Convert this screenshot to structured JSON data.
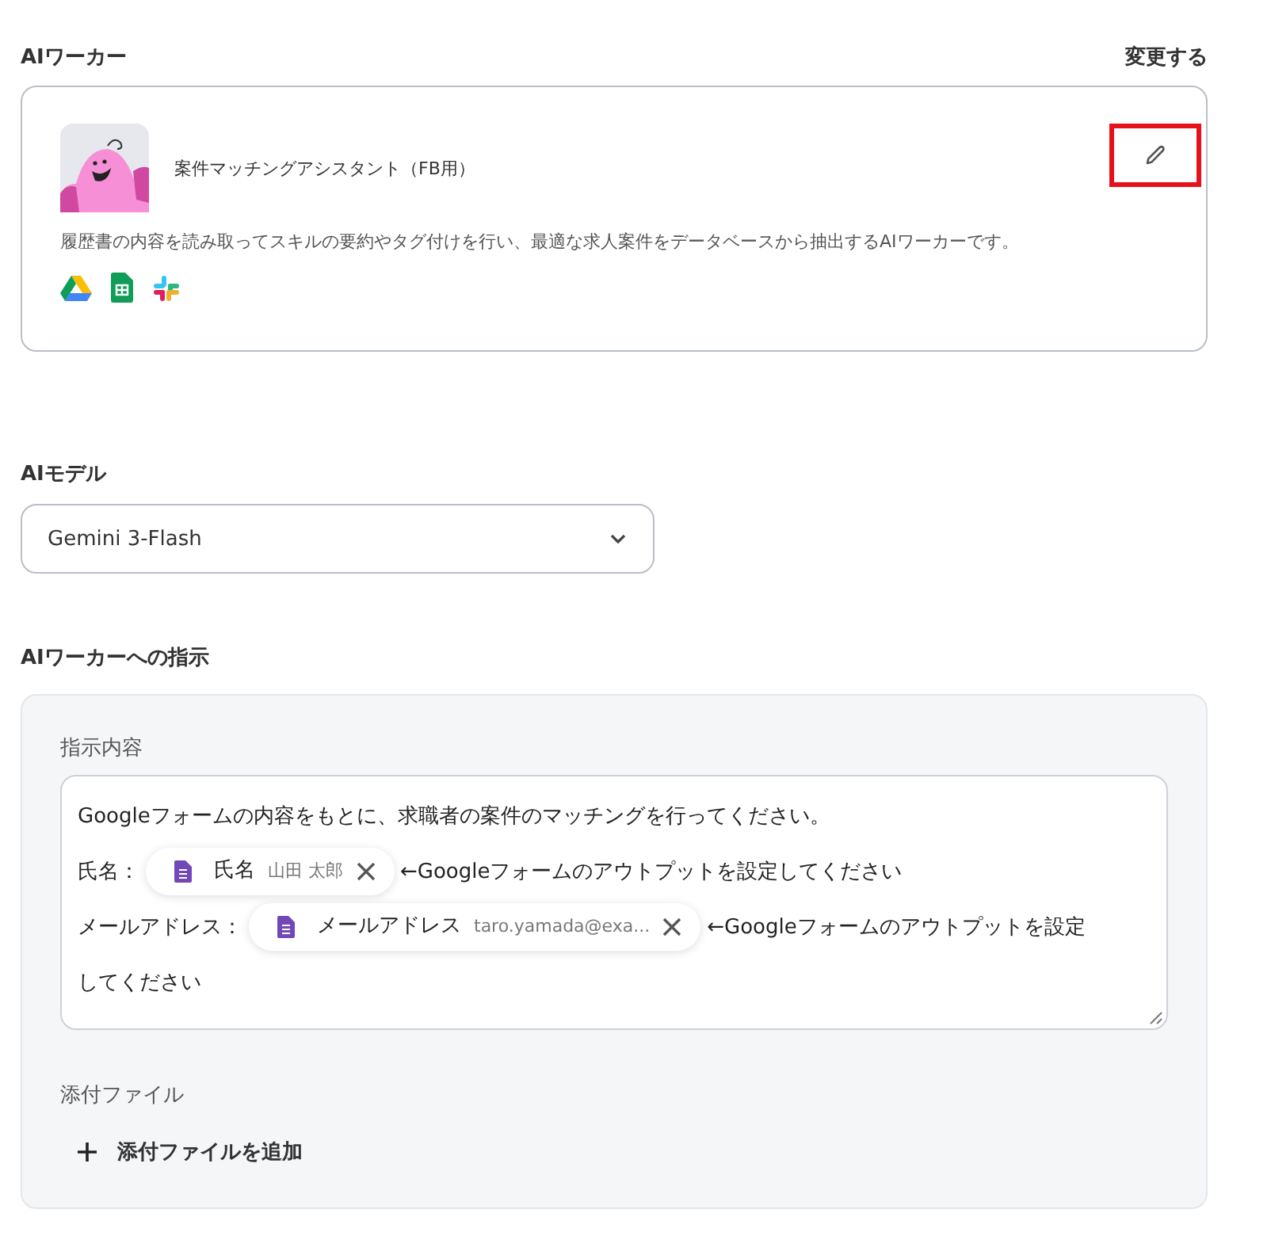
{
  "worker_section": {
    "title": "AIワーカー",
    "change_link": "変更する"
  },
  "worker": {
    "name": "案件マッチングアシスタント（FB用）",
    "description": "履歴書の内容を読み取ってスキルの要約やタグ付けを行い、最適な求人案件をデータベースから抽出するAIワーカーです。",
    "apps": [
      {
        "kind": "drive"
      },
      {
        "kind": "sheets"
      },
      {
        "kind": "slack"
      }
    ],
    "edit_highlighted": true
  },
  "model_section": {
    "title": "AIモデル",
    "value": "Gemini 3-Flash"
  },
  "instruction_section": {
    "title": "AIワーカーへの指示",
    "field_label": "指示内容",
    "lines": [
      [
        {
          "kind": "text",
          "text": "Googleフォームの内容をもとに、求職者の案件のマッチングを行ってください。"
        }
      ],
      [
        {
          "kind": "text",
          "text": "氏名："
        },
        {
          "kind": "chip",
          "label": "氏名",
          "value": "山田 太郎"
        },
        {
          "kind": "text",
          "text": "←Googleフォームのアウトプットを設定してください"
        }
      ],
      [
        {
          "kind": "text",
          "text": "メールアドレス："
        },
        {
          "kind": "chip",
          "label": "メールアドレス",
          "value": "taro.yamada@exa..."
        },
        {
          "kind": "text",
          "text": "←Googleフォームのアウトプットを設定"
        }
      ],
      [
        {
          "kind": "text",
          "text": "してください"
        }
      ]
    ],
    "attachments_label": "添付ファイル",
    "add_attachment": "添付ファイルを追加"
  }
}
